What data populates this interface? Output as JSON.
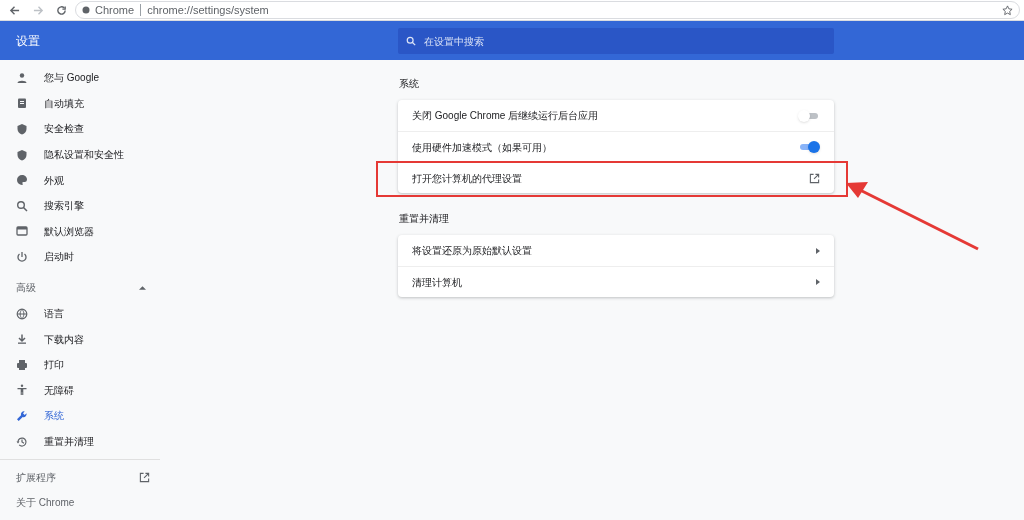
{
  "browser": {
    "site_label": "Chrome",
    "url": "chrome://settings/system"
  },
  "header": {
    "title": "设置",
    "search": {
      "placeholder": "在设置中搜索"
    }
  },
  "sidebar": {
    "items": [
      {
        "label": "您与 Google",
        "selected": false
      },
      {
        "label": "自动填充",
        "selected": false
      },
      {
        "label": "安全检查",
        "selected": false
      },
      {
        "label": "隐私设置和安全性",
        "selected": false
      },
      {
        "label": "外观",
        "selected": false
      },
      {
        "label": "搜索引擎",
        "selected": false
      },
      {
        "label": "默认浏览器",
        "selected": false
      },
      {
        "label": "启动时",
        "selected": false
      }
    ],
    "advanced": {
      "label": "高级",
      "expanded": true,
      "items": [
        {
          "label": "语言",
          "selected": false
        },
        {
          "label": "下载内容",
          "selected": false
        },
        {
          "label": "打印",
          "selected": false
        },
        {
          "label": "无障碍",
          "selected": false
        },
        {
          "label": "系统",
          "selected": true
        },
        {
          "label": "重置并清理",
          "selected": false
        }
      ]
    },
    "footer": [
      {
        "label": "扩展程序",
        "kind": "external"
      },
      {
        "label": "关于 Chrome",
        "kind": "plain"
      }
    ]
  },
  "sections": [
    {
      "title": "系统",
      "rows": [
        {
          "label": "关闭 Google Chrome 后继续运行后台应用",
          "kind": "toggle",
          "on": false,
          "highlighted": false
        },
        {
          "label": "使用硬件加速模式（如果可用）",
          "kind": "toggle",
          "on": true,
          "highlighted": false
        },
        {
          "label": "打开您计算机的代理设置",
          "kind": "external",
          "highlighted": true
        }
      ]
    },
    {
      "title": "重置并清理",
      "rows": [
        {
          "label": "将设置还原为原始默认设置",
          "kind": "arrow",
          "highlighted": false
        },
        {
          "label": "清理计算机",
          "kind": "arrow",
          "highlighted": false
        }
      ]
    }
  ]
}
